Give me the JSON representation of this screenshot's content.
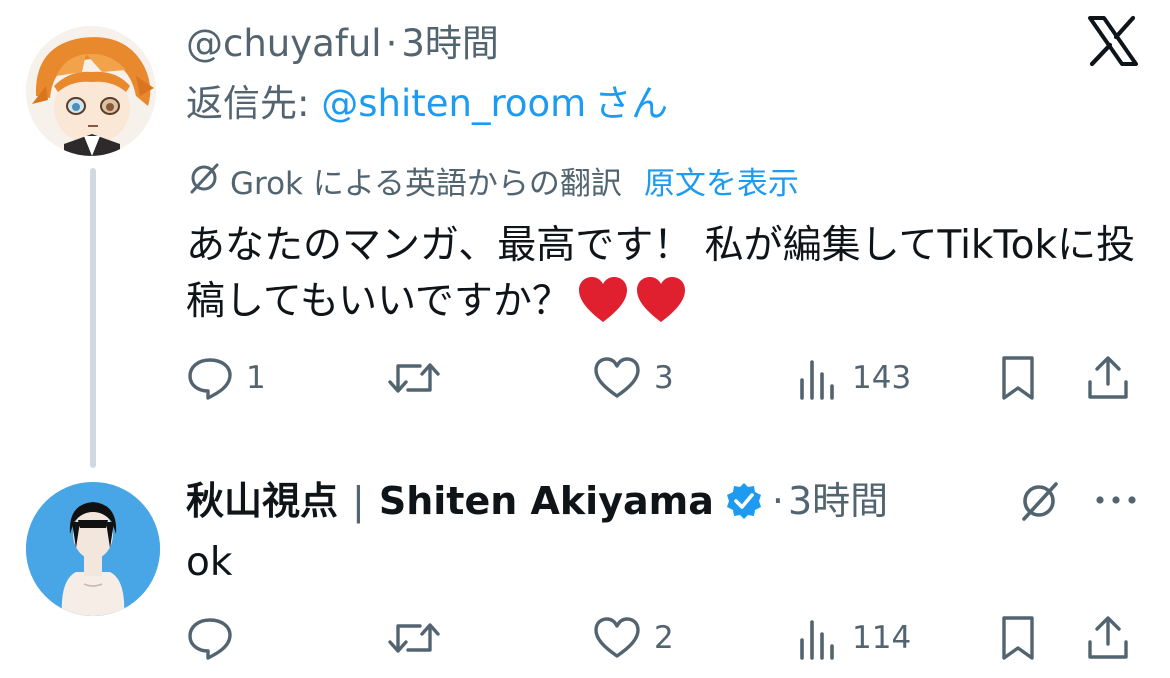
{
  "colors": {
    "accent": "#1d9bf0",
    "secondary_text": "#536471",
    "thread_line": "#cfd9de",
    "heart": "#e0202e"
  },
  "app": {
    "logo": "x-logo-icon"
  },
  "tweet1": {
    "handle": "@chuyaful",
    "dot": "·",
    "time": "3時間",
    "reply_prefix": "返信先: ",
    "reply_to": "@shiten_room",
    "reply_suffix": "さん",
    "translation_note": "Grok による英語からの翻訳",
    "show_original": "原文を表示",
    "text": "あなたのマンガ、最高です！ 私が編集してTikTokに投稿してもいいですか？",
    "emojis": [
      "heart-emoji",
      "heart-emoji"
    ],
    "actions": {
      "replies": "1",
      "retweets": "",
      "likes": "3",
      "views": "143"
    }
  },
  "tweet2": {
    "display_name": "秋山視点",
    "separator": "|",
    "display_name_en": "Shiten Akiyama",
    "verified": true,
    "dot": "·",
    "time": "3時間",
    "text": "ok",
    "actions": {
      "replies": "",
      "retweets": "",
      "likes": "2",
      "views": "114"
    }
  }
}
